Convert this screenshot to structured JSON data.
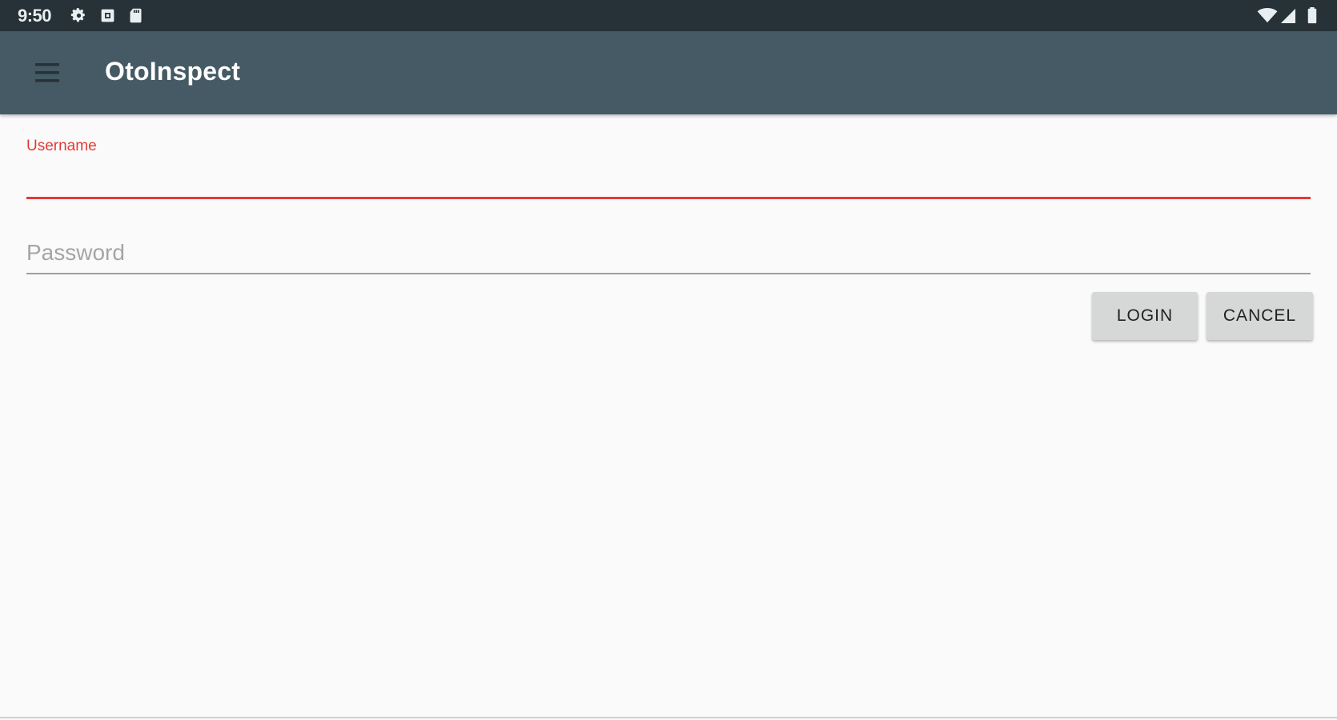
{
  "status_bar": {
    "time": "9:50",
    "left_icons": [
      "gear-icon",
      "notification-box-icon",
      "sd-card-icon"
    ],
    "right_icons": [
      "wifi-icon",
      "cell-signal-icon",
      "battery-icon"
    ]
  },
  "app_bar": {
    "title": "OtoInspect",
    "menu_icon": "hamburger-menu-icon"
  },
  "form": {
    "username": {
      "label": "Username",
      "value": "",
      "placeholder": ""
    },
    "password": {
      "label": "",
      "value": "",
      "placeholder": "Password"
    },
    "login_label": "LOGIN",
    "cancel_label": "CANCEL"
  },
  "colors": {
    "status_bar": "#263238",
    "app_bar": "#455a64",
    "accent_error": "#e53935",
    "button_bg": "#d6d7d7",
    "background": "#fafafa"
  }
}
